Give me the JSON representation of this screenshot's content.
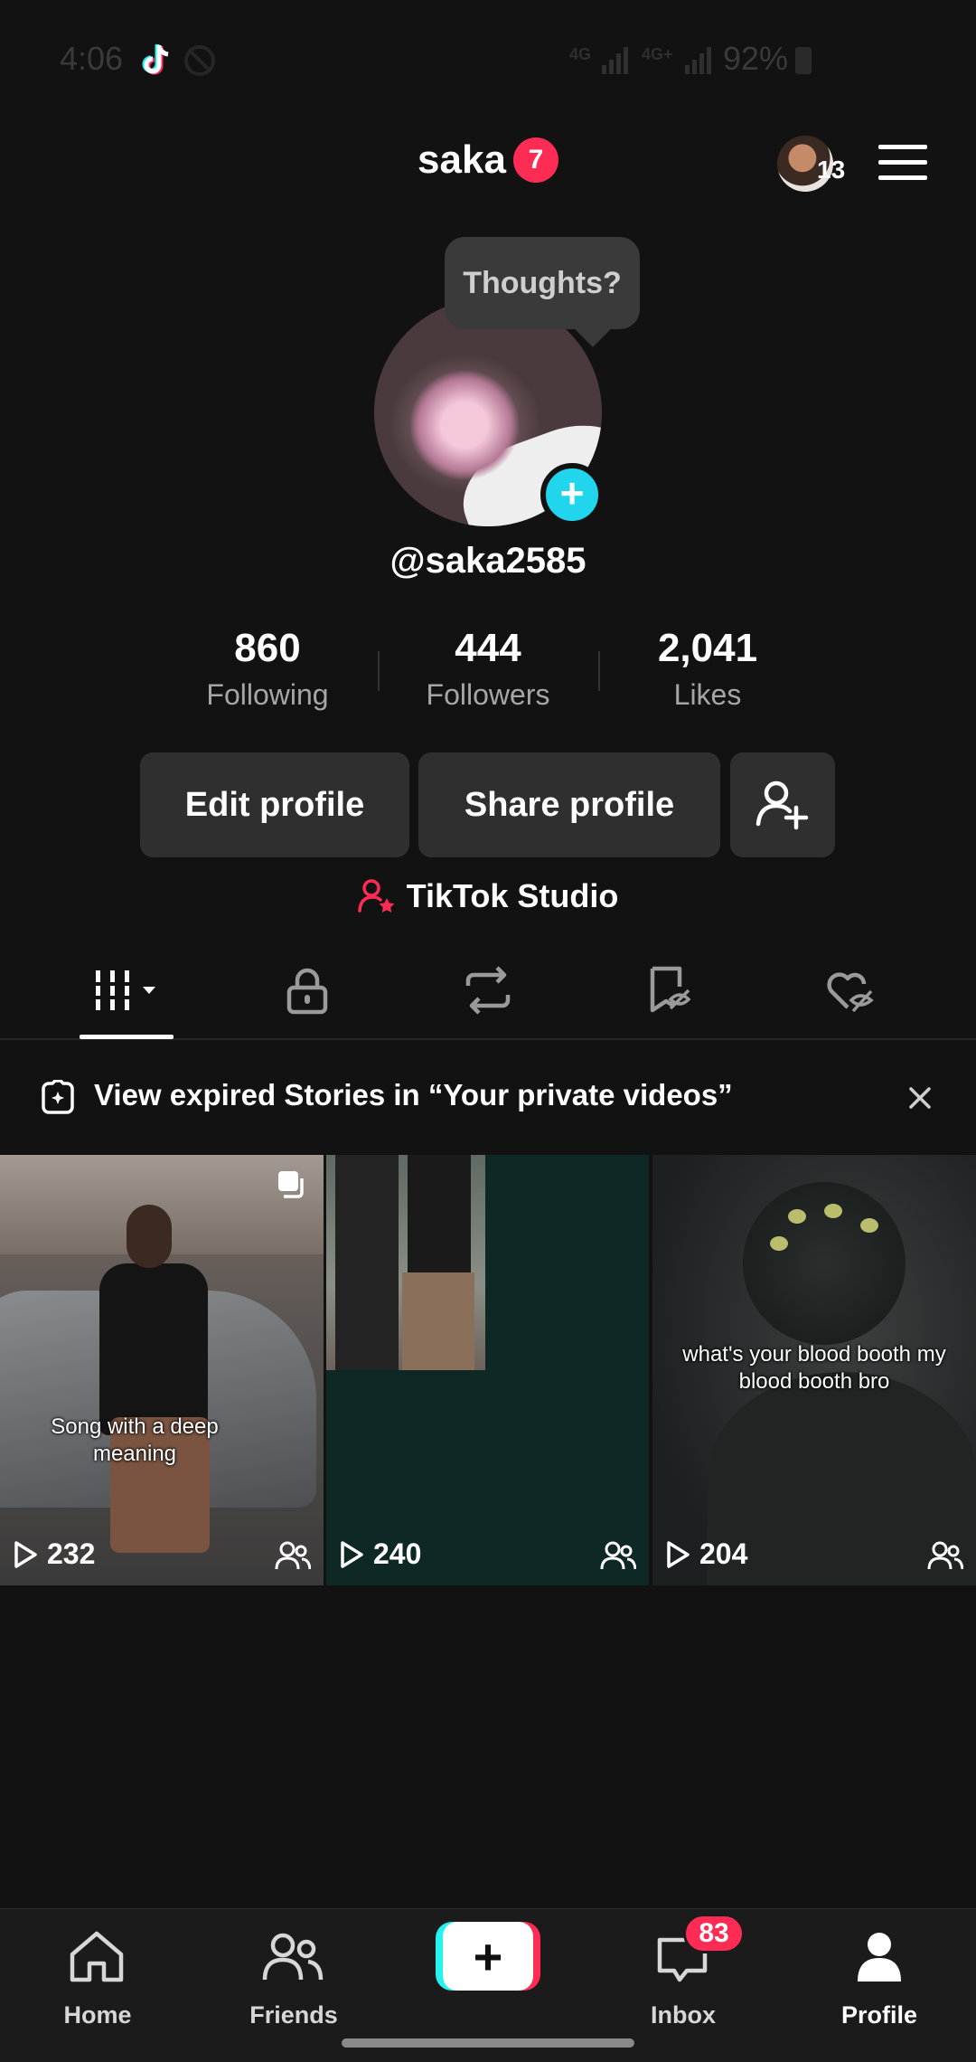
{
  "status_bar": {
    "time": "4:06",
    "net1": "4G",
    "net2": "4G+",
    "battery": "92%"
  },
  "header": {
    "username": "saka",
    "notification_count": "7",
    "friends_count": "13"
  },
  "profile": {
    "thoughts_bubble": "Thoughts?",
    "handle": "@saka2585",
    "stats": [
      {
        "value": "860",
        "label": "Following"
      },
      {
        "value": "444",
        "label": "Followers"
      },
      {
        "value": "2,041",
        "label": "Likes"
      }
    ],
    "edit_label": "Edit profile",
    "share_label": "Share profile",
    "studio_label": "TikTok Studio"
  },
  "tabs": [
    {
      "name": "videos-grid",
      "icon": "grid-icon",
      "active": true
    },
    {
      "name": "private",
      "icon": "lock-icon"
    },
    {
      "name": "reposts",
      "icon": "repost-icon"
    },
    {
      "name": "favorites",
      "icon": "bookmark-hidden-icon"
    },
    {
      "name": "liked",
      "icon": "heart-hidden-icon"
    }
  ],
  "banner": {
    "text": "View expired Stories in “Your private videos”"
  },
  "videos": [
    {
      "views": "232",
      "caption": "Song with a deep meaning"
    },
    {
      "views": "240",
      "caption": ""
    },
    {
      "views": "204",
      "caption": "what's your blood booth my blood booth bro"
    }
  ],
  "nav": {
    "home": "Home",
    "friends": "Friends",
    "inbox": "Inbox",
    "inbox_badge": "83",
    "profile": "Profile"
  },
  "colors": {
    "accent_pink": "#fe2c55",
    "accent_cyan": "#25f4ee",
    "background": "#121212"
  }
}
